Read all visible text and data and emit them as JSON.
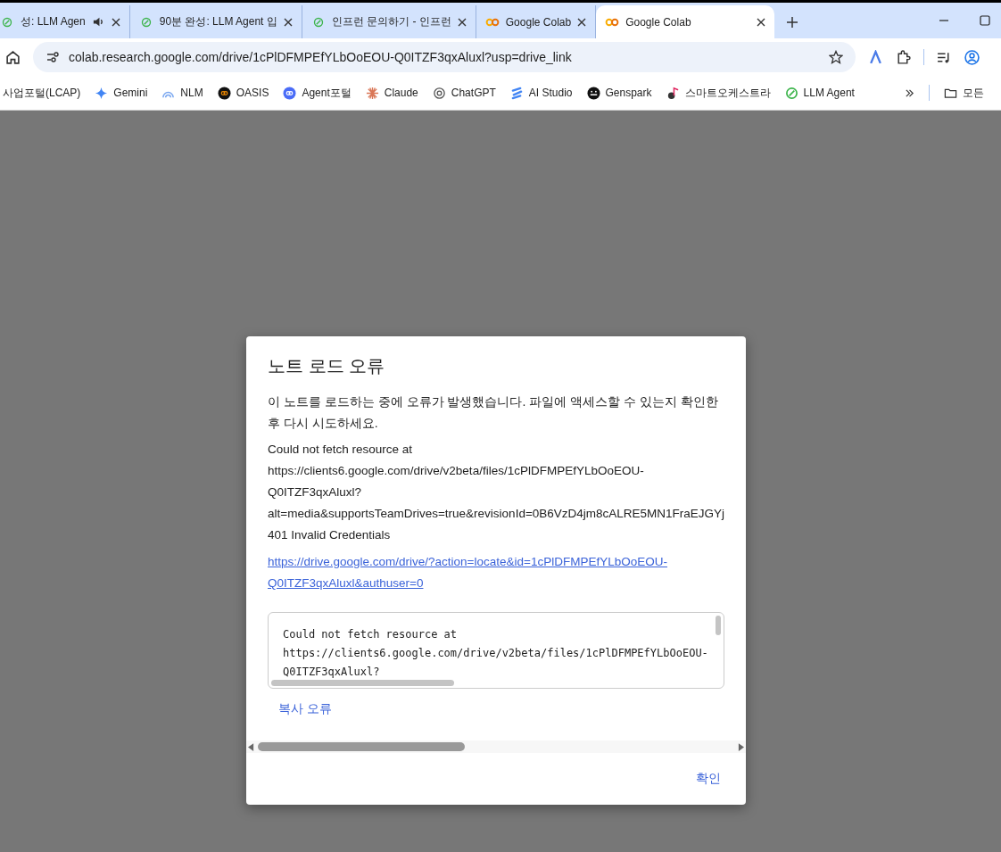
{
  "tabs": [
    {
      "title": "성: LLM Agen",
      "audio": true,
      "selected": false
    },
    {
      "title": "90분 완성: LLM Agent 입",
      "audio": false,
      "selected": false
    },
    {
      "title": "인프런 문의하기 - 인프런",
      "audio": false,
      "selected": false
    },
    {
      "title": "Google Colab",
      "audio": false,
      "selected": false
    },
    {
      "title": "Google Colab",
      "audio": false,
      "selected": true
    }
  ],
  "address_bar": {
    "url": "colab.research.google.com/drive/1cPlDFMPEfYLbOoEOU-Q0ITZF3qxAluxl?usp=drive_link"
  },
  "bookmarks": [
    {
      "label": "사업포털(LCAP)"
    },
    {
      "label": "Gemini"
    },
    {
      "label": "NLM"
    },
    {
      "label": "OASIS"
    },
    {
      "label": "Agent포털"
    },
    {
      "label": "Claude"
    },
    {
      "label": "ChatGPT"
    },
    {
      "label": "AI Studio"
    },
    {
      "label": "Genspark"
    },
    {
      "label": "스마트오케스트라"
    },
    {
      "label": "LLM Agent"
    }
  ],
  "bookmarks_folder": {
    "label": "모든"
  },
  "dialog": {
    "title": "노트 로드 오류",
    "message": "이 노트를 로드하는 중에 오류가 발생했습니다. 파일에 액세스할 수 있는지 확인한 후 다시 시도하세요.",
    "error_lines": [
      "Could not fetch resource at",
      "https://clients6.google.com/drive/v2beta/files/1cPlDFMPEfYLbOoEOU-",
      "Q0ITZF3qxAluxl?",
      "alt=media&supportsTeamDrives=true&revisionId=0B6VzD4jm8cALRE5MN1FraEJGYj",
      "401 Invalid Credentials"
    ],
    "link_lines": [
      "https://drive.google.com/drive/?action=locate&id=1cPlDFMPEfYLbOoEOU-",
      "Q0ITZF3qxAluxl&authuser=0"
    ],
    "code_lines": [
      "Could not fetch resource at",
      "https://clients6.google.com/drive/v2beta/files/1cPlDFMPEfYLbOoEOU-",
      "Q0ITZF3qxAluxl?"
    ],
    "copy_button": "복사 오류",
    "ok_button": "확인"
  }
}
